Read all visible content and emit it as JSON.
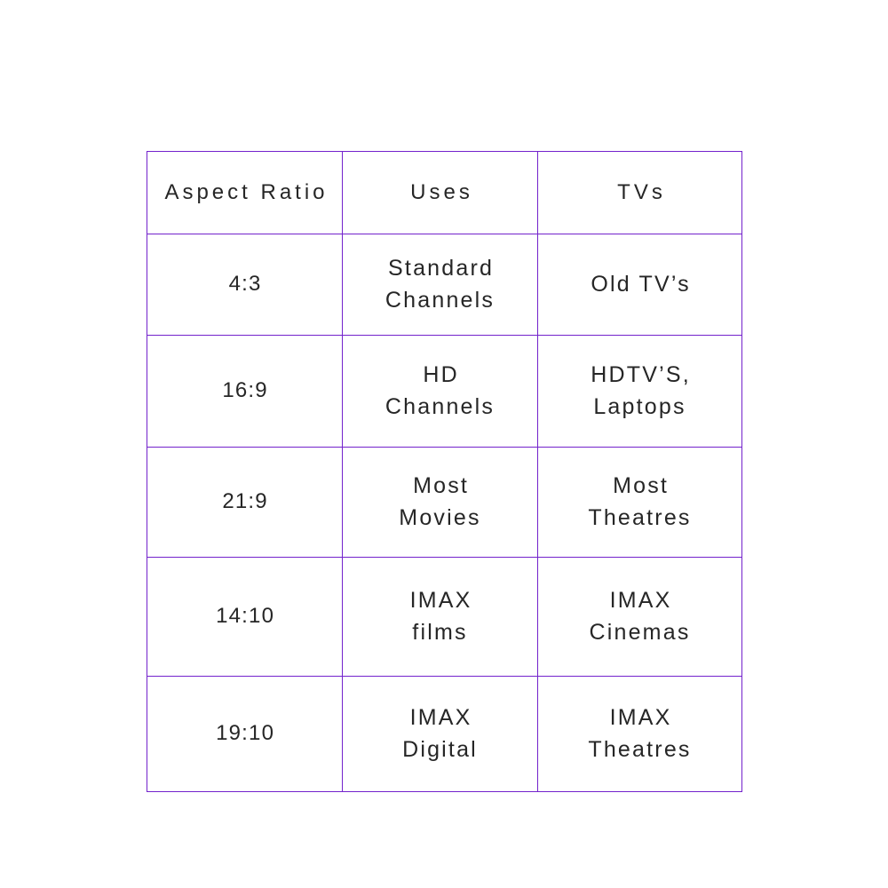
{
  "table": {
    "columns": [
      "Aspect\nRatio",
      "Uses",
      "TVs"
    ],
    "border_color": "#7322cc",
    "text_color": "#262626",
    "background_color": "#ffffff",
    "rows": [
      {
        "ratio": "4:3",
        "uses": "Standard\nChannels",
        "tvs": "Old TV’s"
      },
      {
        "ratio": "16:9",
        "uses": "HD\nChannels",
        "tvs": "HDTV’S,\nLaptops"
      },
      {
        "ratio": "21:9",
        "uses": "Most\nMovies",
        "tvs": "Most\nTheatres"
      },
      {
        "ratio": "14:10",
        "uses": "IMAX\nfilms",
        "tvs": "IMAX\nCinemas"
      },
      {
        "ratio": "19:10",
        "uses": "IMAX\nDigital",
        "tvs": "IMAX\nTheatres"
      }
    ]
  }
}
